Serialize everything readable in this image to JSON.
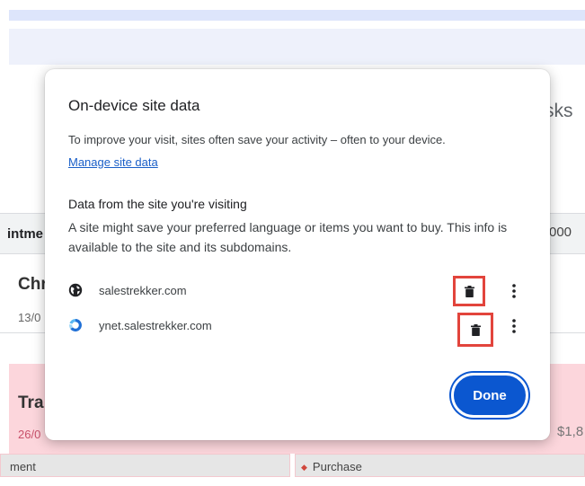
{
  "background": {
    "tasks_fragment": "sks",
    "column_left_fragment": "intme",
    "column_right_fragment": "000",
    "item1_title_fragment": "Chr",
    "item1_date_fragment": "13/0",
    "item2_title_fragment": "Tra",
    "item2_date_fragment": "26/0",
    "item2_amount_fragment": "$1,8",
    "tag1_label": "ment",
    "tag2_label": "Purchase",
    "colors": {
      "header_bar": "#dde5fb",
      "pink_row": "#fcd6dc"
    }
  },
  "dialog": {
    "title": "On-device site data",
    "description": "To improve your visit, sites often save your activity – often to your device.",
    "manage_link": "Manage site data",
    "section_title": "Data from the site you're visiting",
    "section_description": "A site might save your preferred language or items you want to buy. This info is available to the site and its subdomains.",
    "sites": [
      {
        "name": "salestrekker.com",
        "icon": "globe-icon",
        "actions": [
          "delete-icon",
          "more-vert-icon"
        ]
      },
      {
        "name": "ynet.salestrekker.com",
        "icon": "site-favicon",
        "actions": [
          "delete-icon",
          "more-vert-icon"
        ]
      }
    ],
    "done_label": "Done",
    "colors": {
      "accent": "#0b57d0",
      "highlight": "#e2443c",
      "link": "#1a5fc8"
    }
  }
}
